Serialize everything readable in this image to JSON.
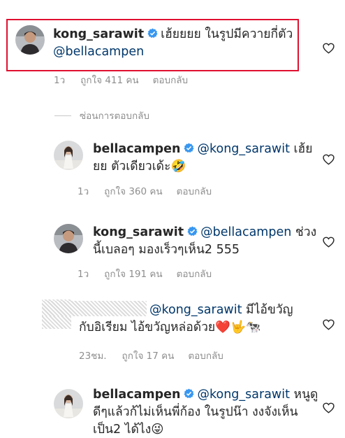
{
  "colors": {
    "username": "#262626",
    "mention": "#00376b",
    "meta": "#8e8e8e",
    "verified": "#3897f0",
    "highlight": "#e0102f",
    "heart_emoji": "#e0102f"
  },
  "comments": [
    {
      "username": "kong_sarawit",
      "verified": true,
      "line1": "เฮ้ยยยย ในรูปมีควายกี่ตัว",
      "line2_mention": "@bellacampen",
      "time": "1ว",
      "likes": "ถูกใจ 411 คน",
      "reply": "ตอบกลับ",
      "avatar_icon": "profile-avatar-man",
      "like_icon": "heart-outline-icon"
    },
    {
      "username": "bellacampen",
      "verified": true,
      "mention": "@kong_sarawit",
      "line1_text": "เฮ้ย",
      "line2_text": "ยย ตัวเดียวเด้ะ",
      "emoji": "🤣",
      "time": "1ว",
      "likes": "ถูกใจ 360 คน",
      "reply": "ตอบกลับ",
      "avatar_icon": "profile-avatar-woman"
    },
    {
      "username": "kong_sarawit",
      "verified": true,
      "mention": "@bellacampen",
      "line1_text": "ช่วง",
      "line2_text": "นี้เบลอๆ มองเร็วๆเห็น2 555",
      "time": "1ว",
      "likes": "ถูกใจ 191 คน",
      "reply": "ตอบกลับ",
      "avatar_icon": "profile-avatar-man"
    },
    {
      "username": "",
      "mention": "@kong_sarawit",
      "line1_text": "มีไอ้ขวัญ",
      "line2_text": "กับอิเรียม ไอ้ขวัญหล่อด้วย",
      "emoji": "❤️🤟🐄",
      "time": "23ชม.",
      "likes": "ถูกใจ 17 คน",
      "reply": "ตอบกลับ"
    },
    {
      "username": "bellacampen",
      "verified": true,
      "mention": "@kong_sarawit",
      "line1_text": "หนูดู",
      "line2_text": "ดีๆแล้วก้ไม่เห็นพี่ก้อง ในรูปน๊า งงจังเห็น",
      "line3_text": "เป็น2 ได้ไง",
      "emoji": "😜",
      "avatar_icon": "profile-avatar-woman"
    }
  ],
  "hide_replies": "ซ่อนการตอบกลับ"
}
